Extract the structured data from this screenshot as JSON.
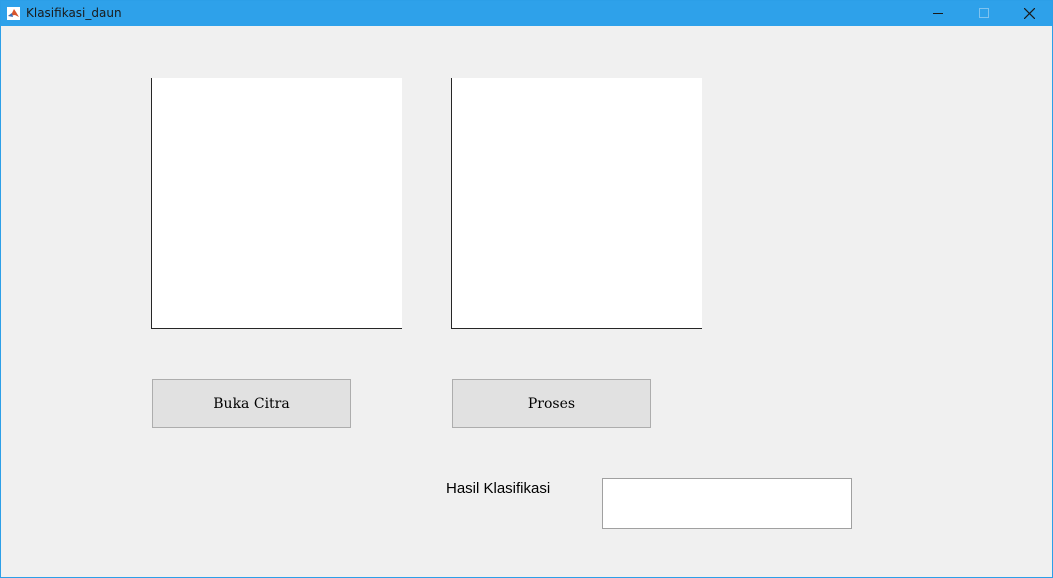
{
  "window": {
    "title": "Klasifikasi_daun",
    "accent_color": "#2ea1ea",
    "controls": [
      "minimize-icon",
      "maximize-icon",
      "close-icon"
    ]
  },
  "axes": {
    "left_label": "",
    "right_label": ""
  },
  "buttons": {
    "open_image": "Buka Citra",
    "process": "Proses"
  },
  "result": {
    "label": "Hasil Klasifikasi",
    "value": ""
  }
}
